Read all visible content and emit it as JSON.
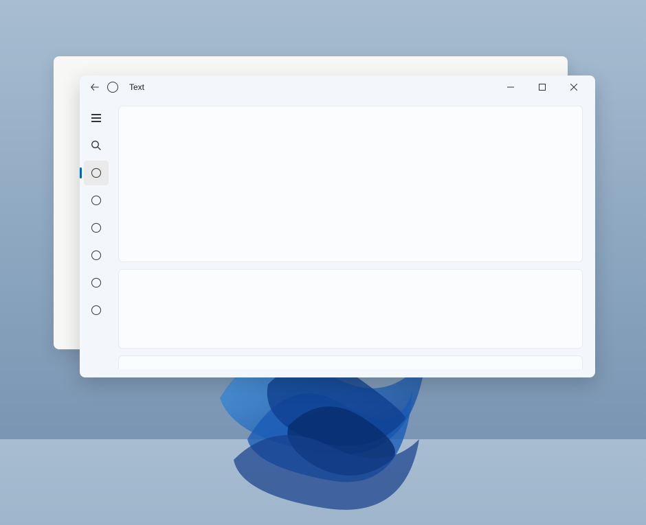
{
  "window": {
    "title": "Text"
  },
  "nav": {
    "items": [
      {
        "type": "hamburger",
        "selected": false
      },
      {
        "type": "search",
        "selected": false
      },
      {
        "type": "circle",
        "selected": true
      },
      {
        "type": "circle",
        "selected": false
      },
      {
        "type": "circle",
        "selected": false
      },
      {
        "type": "circle",
        "selected": false
      },
      {
        "type": "circle",
        "selected": false
      },
      {
        "type": "circle",
        "selected": false
      }
    ]
  }
}
